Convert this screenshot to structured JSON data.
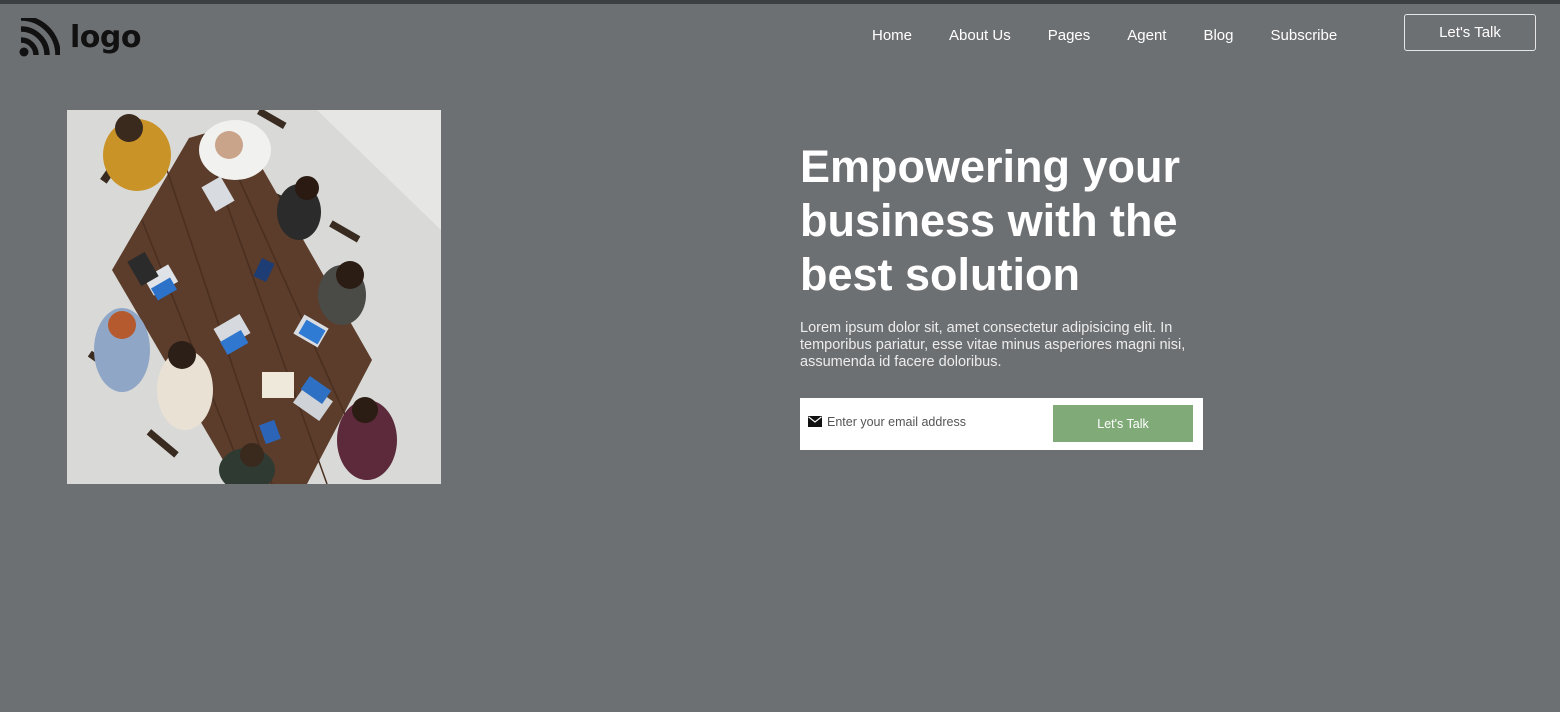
{
  "brand": {
    "logo_text": "logo",
    "logo_icon": "feed-icon"
  },
  "nav": {
    "items": [
      {
        "label": "Home"
      },
      {
        "label": "About Us"
      },
      {
        "label": "Pages"
      },
      {
        "label": "Agent"
      },
      {
        "label": "Blog"
      },
      {
        "label": "Subscribe"
      }
    ],
    "cta_label": "Let's Talk"
  },
  "hero": {
    "title": "Empowering your business with the best solution",
    "description": "Lorem ipsum dolor sit, amet consectetur adipisicing elit. In temporibus pariatur, esse vitae minus asperiores magni nisi, assumenda id facere doloribus.",
    "image_subject": "team-meeting-photo"
  },
  "signup": {
    "icon": "envelope-icon",
    "placeholder": "Enter your email address",
    "button_label": "Let's Talk"
  },
  "colors": {
    "background": "#6d7073",
    "top_strip": "#3d4043",
    "accent_button": "#80ab78",
    "text": "#ffffff"
  }
}
